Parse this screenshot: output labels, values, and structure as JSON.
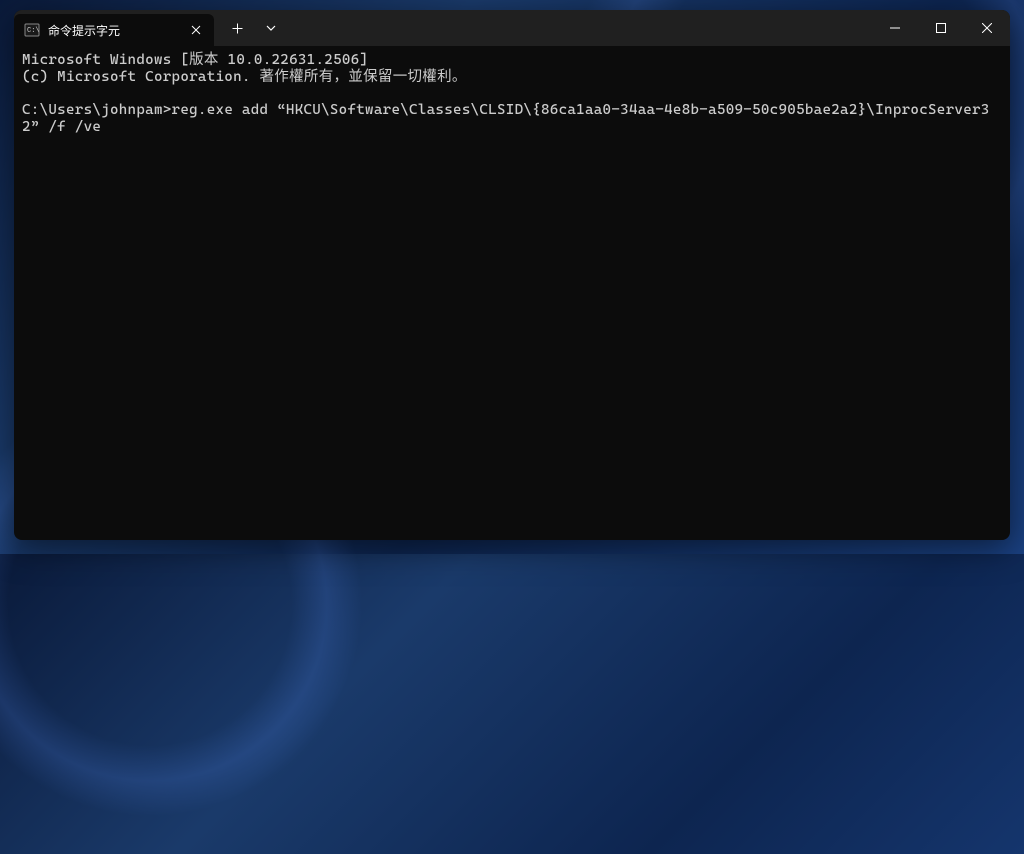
{
  "tab": {
    "title": "命令提示字元"
  },
  "terminal": {
    "line1": "Microsoft Windows [版本 10.0.22631.2506]",
    "line2": "(c) Microsoft Corporation. 著作權所有，並保留一切權利。",
    "prompt": "C:\\Users\\johnpam>",
    "command": "reg.exe add “HKCU\\Software\\Classes\\CLSID\\{86ca1aa0-34aa-4e8b-a509-50c905bae2a2}\\InprocServer32” /f /ve"
  }
}
